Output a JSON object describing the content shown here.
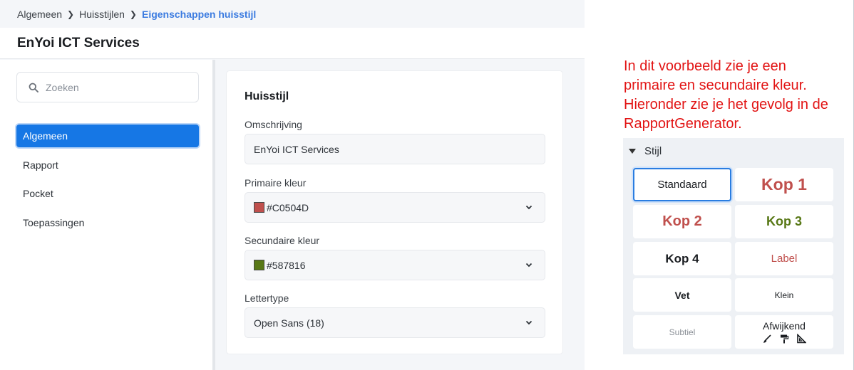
{
  "breadcrumb": {
    "items": [
      "Algemeen",
      "Huisstijlen"
    ],
    "current": "Eigenschappen huisstijl"
  },
  "header": {
    "title": "EnYoi ICT Services"
  },
  "sidebar": {
    "search_placeholder": "Zoeken",
    "items": [
      {
        "label": "Algemeen",
        "active": true
      },
      {
        "label": "Rapport",
        "active": false
      },
      {
        "label": "Pocket",
        "active": false
      },
      {
        "label": "Toepassingen",
        "active": false
      }
    ]
  },
  "form": {
    "section_title": "Huisstijl",
    "omschrijving": {
      "label": "Omschrijving",
      "value": "EnYoi ICT Services"
    },
    "primaire_kleur": {
      "label": "Primaire kleur",
      "value": "#C0504D",
      "color": "#c0504d"
    },
    "secundaire_kleur": {
      "label": "Secundaire kleur",
      "value": "#587816",
      "color": "#587816"
    },
    "lettertype": {
      "label": "Lettertype",
      "value": "Open Sans (18)"
    }
  },
  "annotation": {
    "lines": [
      "In dit voorbeeld zie je een",
      "primaire en secundaire kleur.",
      "Hieronder zie je het gevolg in de",
      "RapportGenerator."
    ]
  },
  "stijl": {
    "title": "Stijl",
    "tiles": {
      "standaard": "Standaard",
      "kop1": "Kop 1",
      "kop2": "Kop 2",
      "kop3": "Kop 3",
      "kop4": "Kop 4",
      "label": "Label",
      "vet": "Vet",
      "klein": "Klein",
      "subtiel": "Subtiel",
      "afwijkend": "Afwijkend"
    },
    "afwijkend_icons": [
      "brush-icon",
      "paint-roller-icon",
      "set-square-icon"
    ]
  },
  "colors": {
    "accent": "#1677e5",
    "breadcrumb_current": "#3b7be0",
    "annotation": "#e21414",
    "primary": "#c0504d",
    "secondary": "#587816"
  }
}
